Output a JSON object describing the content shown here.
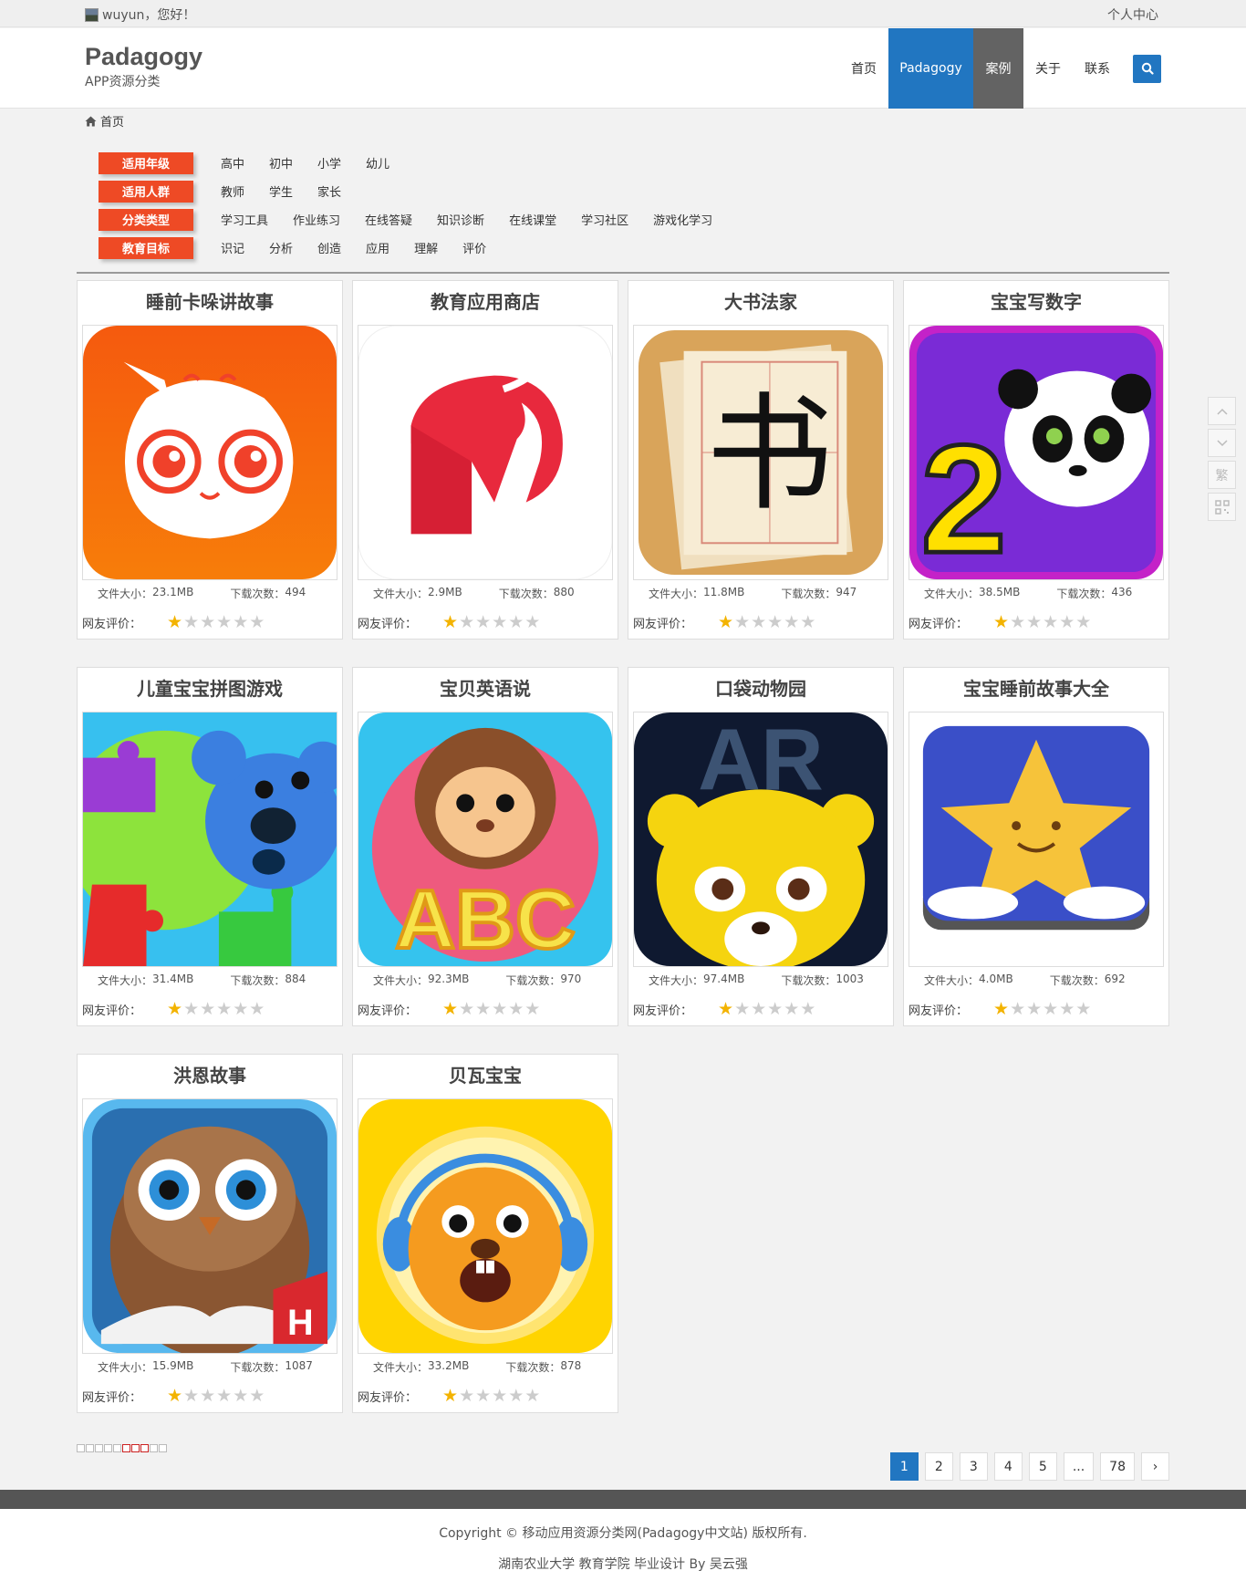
{
  "topbar": {
    "greeting": "wuyun，您好！",
    "user_center": "个人中心"
  },
  "brand": {
    "name": "Padagogy",
    "subtitle": "APP资源分类"
  },
  "nav": {
    "items": [
      "首页",
      "Padagogy",
      "案例",
      "关于",
      "联系"
    ]
  },
  "breadcrumb": {
    "home": "首页"
  },
  "filters": [
    {
      "tag": "适用年级",
      "options": [
        "高中",
        "初中",
        "小学",
        "幼儿"
      ]
    },
    {
      "tag": "适用人群",
      "options": [
        "教师",
        "学生",
        "家长"
      ]
    },
    {
      "tag": "分类类型",
      "options": [
        "学习工具",
        "作业练习",
        "在线答疑",
        "知识诊断",
        "在线课堂",
        "学习社区",
        "游戏化学习"
      ]
    },
    {
      "tag": "教育目标",
      "options": [
        "识记",
        "分析",
        "创造",
        "应用",
        "理解",
        "评价"
      ]
    }
  ],
  "labels": {
    "size": "文件大小：",
    "downloads": "下载次数：",
    "rating": "网友评价："
  },
  "apps": [
    {
      "title": "睡前卡哚讲故事",
      "size": "23.1MB",
      "downloads": "494",
      "stars": 1
    },
    {
      "title": "教育应用商店",
      "size": "2.9MB",
      "downloads": "880",
      "stars": 1
    },
    {
      "title": "大书法家",
      "size": "11.8MB",
      "downloads": "947",
      "stars": 1
    },
    {
      "title": "宝宝写数字",
      "size": "38.5MB",
      "downloads": "436",
      "stars": 1
    },
    {
      "title": "儿童宝宝拼图游戏",
      "size": "31.4MB",
      "downloads": "884",
      "stars": 1
    },
    {
      "title": "宝贝英语说",
      "size": "92.3MB",
      "downloads": "970",
      "stars": 1
    },
    {
      "title": "口袋动物园",
      "size": "97.4MB",
      "downloads": "1003",
      "stars": 1
    },
    {
      "title": "宝宝睡前故事大全",
      "size": "4.0MB",
      "downloads": "692",
      "stars": 1
    },
    {
      "title": "洪恩故事",
      "size": "15.9MB",
      "downloads": "1087",
      "stars": 1
    },
    {
      "title": "贝瓦宝宝",
      "size": "33.2MB",
      "downloads": "878",
      "stars": 1
    }
  ],
  "icon_texts": {
    "calligraphy": "书",
    "number": "2",
    "abc": "ABC",
    "ar": "AR",
    "h": "H"
  },
  "pagination": {
    "pages": [
      "1",
      "2",
      "3",
      "4",
      "5",
      "...",
      "78"
    ],
    "next": "›",
    "current": "1"
  },
  "side_tools": {
    "traditional": "繁"
  },
  "footer": {
    "copyright": "Copyright ©  移动应用资源分类网(Padagogy中文站)  版权所有.",
    "credit": "湖南农业大学 教育学院 毕业设计 By 吴云强"
  },
  "colors": {
    "accent": "#2176c1",
    "tag": "#ee4a25",
    "star": "#f3b300"
  }
}
